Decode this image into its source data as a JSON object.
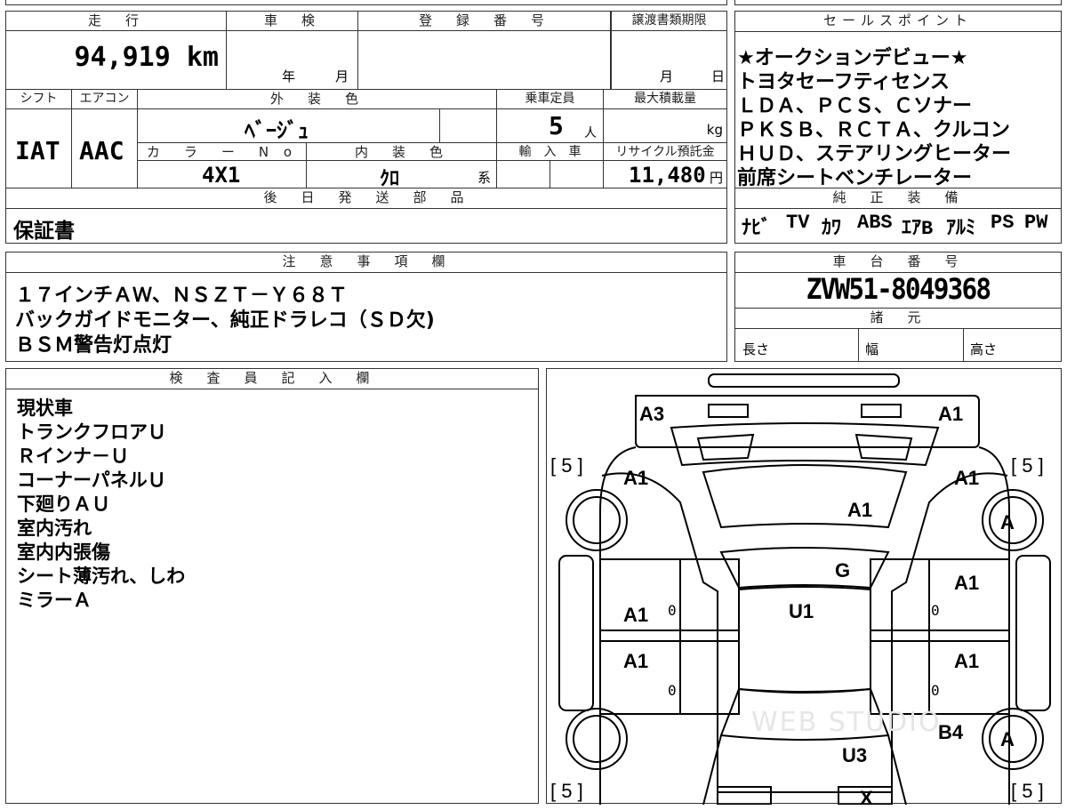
{
  "headers": {
    "mileage": "走　行",
    "inspection": "車　検",
    "registration": "登　録　番　号",
    "transfer_deadline": "譲渡書類期限",
    "shift": "シフト",
    "aircon": "エアコン",
    "exterior_color": "外　装　色",
    "capacity": "乗車定員",
    "max_load": "最大積載量",
    "color_no": "カ　ラ　ー　N o .",
    "interior_color": "内　装　色",
    "import": "輸　入　車",
    "recycle": "リサイクル預託金",
    "later_parts": "後　日　発　送　部　品",
    "sales_points": "セールスポイント",
    "genuine_equipment": "純　正　装　備",
    "notes": "注　意　事　項　欄",
    "chassis_no": "車　台　番　号",
    "specs": "諸　元",
    "inspector": "検　査　員　記　入　欄"
  },
  "mileage": "94,919 km",
  "inspection": {
    "year": "年",
    "month": "月"
  },
  "transfer": {
    "month": "月",
    "day": "日"
  },
  "shift": "IAT",
  "aircon": "AAC",
  "exterior_color": "ﾍﾞｰｼﾞｭ",
  "capacity": {
    "value": "5",
    "unit": "人"
  },
  "max_load_unit": "kg",
  "color_no": "4X1",
  "interior_color": {
    "value": "ｸﾛ",
    "suffix": "系"
  },
  "recycle": {
    "value": "11,480",
    "unit": "円"
  },
  "later_parts": "保証書",
  "sales_points": [
    "★オークションデビュー★",
    "トヨタセーフティセンス",
    "ＬＤＡ、ＰＣＳ、Ｃソナー",
    "ＰＫＳＢ、ＲＣＴＡ、クルコン",
    "ＨＵＤ、ステアリングヒーター",
    "前席シートベンチレーター"
  ],
  "equipment": [
    "ﾅﾋﾞ",
    "TV",
    "ｶﾜ",
    "ABS",
    "ｴｱB",
    "ｱﾙﾐ",
    "PS",
    "PW"
  ],
  "notes": [
    "１７インチＡＷ、ＮＳＺＴ－Ｙ６８Ｔ",
    "バックガイドモニター、純正ドラレコ（ＳＤ欠)",
    "ＢＳＭ警告灯点灯"
  ],
  "chassis_no": "ZVW51-8049368",
  "specs": {
    "length": "長さ",
    "width": "幅",
    "height": "高さ"
  },
  "inspector_notes": [
    "現状車",
    "トランクフロアＵ",
    "Ｒインナ－Ｕ",
    "コーナーパネルＵ",
    "下廻りＡＵ",
    "室内汚れ",
    "室内内張傷",
    "シート薄汚れ、しわ",
    "ミラーＡ"
  ],
  "diagram": {
    "marks": {
      "rear_left": "A3",
      "rear_right": "A1",
      "left_rear_quarter": "A1",
      "right_rear_quarter": "A1",
      "trunk": "A1",
      "rear_glass": "G",
      "right_rear_door": "A1",
      "left_rear_door": "A1",
      "roof": "U1",
      "left_front_door": "A1",
      "right_front_door": "A1",
      "right_front_fender": "B4",
      "right_rear_wheel": "A",
      "right_front_wheel": "A",
      "hood": "U3",
      "front": "X"
    },
    "tire_tl": "[ 5 ]",
    "tire_tr": "[ 5 ]",
    "tire_bl": "[ 5 ]",
    "tire_br": "[ 5 ]",
    "zero": "0",
    "watermark": "WEB STUDIO"
  }
}
